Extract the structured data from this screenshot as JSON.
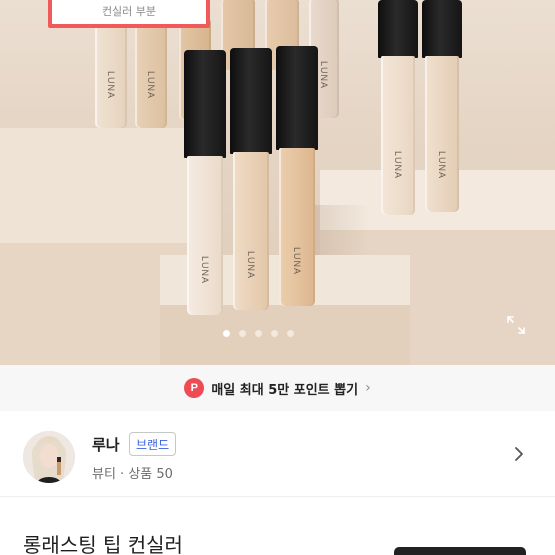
{
  "hero": {
    "banner_text": "컨실러 부분",
    "tube_brand": "LUNA",
    "slide_count": 5,
    "active_slide": 1
  },
  "points": {
    "badge": "P",
    "text": "매일 최대 5만 포인트 뽑기",
    "chevron": "›"
  },
  "seller": {
    "name": "루나",
    "tag": "브랜드",
    "meta": "뷰티 · 상품 50"
  },
  "product": {
    "title": "롱래스팅 팁 컨실러"
  },
  "colors": {
    "accent_red": "#ee4b55",
    "banner_border": "#f15a5a",
    "brand_tag_text": "#3a60e0"
  },
  "icons": {
    "expand": "expand-icon",
    "chevron": "chevron-right-icon"
  }
}
